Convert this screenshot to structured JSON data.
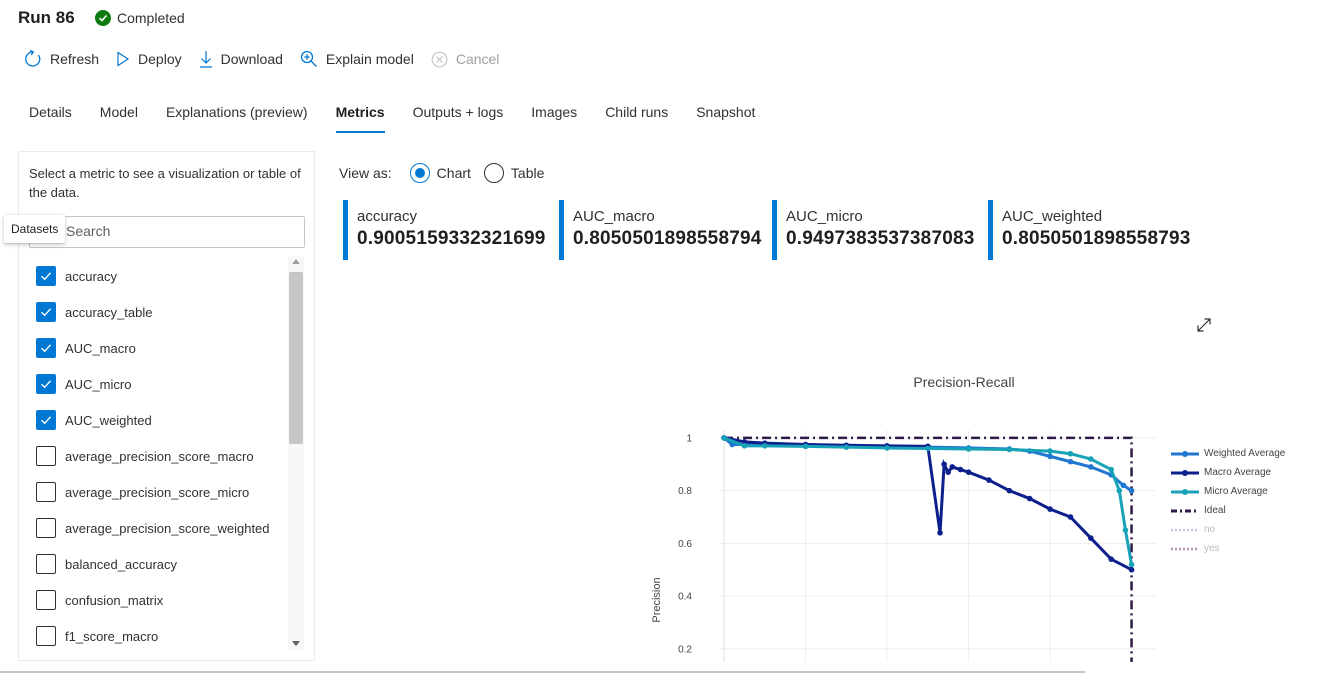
{
  "header": {
    "run_title": "Run 86",
    "status": "Completed",
    "status_color": "#107c10"
  },
  "toolbar": {
    "refresh": "Refresh",
    "deploy": "Deploy",
    "download": "Download",
    "explain_model": "Explain model",
    "cancel": "Cancel"
  },
  "tabs": [
    {
      "label": "Details",
      "active": false
    },
    {
      "label": "Model",
      "active": false
    },
    {
      "label": "Explanations (preview)",
      "active": false
    },
    {
      "label": "Metrics",
      "active": true
    },
    {
      "label": "Outputs + logs",
      "active": false
    },
    {
      "label": "Images",
      "active": false
    },
    {
      "label": "Child runs",
      "active": false
    },
    {
      "label": "Snapshot",
      "active": false
    }
  ],
  "left_panel": {
    "hint": "Select a metric to see a visualization or table of the data.",
    "search_placeholder": "Search",
    "tooltip": "Datasets",
    "metrics": [
      {
        "label": "accuracy",
        "checked": true
      },
      {
        "label": "accuracy_table",
        "checked": true
      },
      {
        "label": "AUC_macro",
        "checked": true
      },
      {
        "label": "AUC_micro",
        "checked": true
      },
      {
        "label": "AUC_weighted",
        "checked": true
      },
      {
        "label": "average_precision_score_macro",
        "checked": false
      },
      {
        "label": "average_precision_score_micro",
        "checked": false
      },
      {
        "label": "average_precision_score_weighted",
        "checked": false
      },
      {
        "label": "balanced_accuracy",
        "checked": false
      },
      {
        "label": "confusion_matrix",
        "checked": false
      },
      {
        "label": "f1_score_macro",
        "checked": false
      }
    ]
  },
  "view_as": {
    "label": "View as:",
    "options": [
      {
        "label": "Chart",
        "selected": true
      },
      {
        "label": "Table",
        "selected": false
      }
    ]
  },
  "cards": [
    {
      "name": "accuracy",
      "value": "0.9005159332321699"
    },
    {
      "name": "AUC_macro",
      "value": "0.8050501898558794"
    },
    {
      "name": "AUC_micro",
      "value": "0.9497383537387083"
    },
    {
      "name": "AUC_weighted",
      "value": "0.8050501898558793"
    }
  ],
  "accent_color": "#0078d4",
  "chart_data": {
    "type": "line",
    "title": "Precision-Recall",
    "ylabel": "Precision",
    "xlabel": "",
    "ylim": [
      0.15,
      1.03
    ],
    "xlim": [
      -0.01,
      1.06
    ],
    "y_ticks": [
      "1",
      "0.8",
      "0.6",
      "0.4",
      "0.2"
    ],
    "y_tick_values": [
      1,
      0.8,
      0.6,
      0.4,
      0.2
    ],
    "legend_position": "right",
    "series": [
      {
        "name": "Weighted Average",
        "color": "#1f77d0",
        "dash": "solid",
        "markers": true,
        "dimmed": false,
        "x": [
          0,
          0.02,
          0.1,
          0.2,
          0.3,
          0.4,
          0.5,
          0.6,
          0.7,
          0.75,
          0.8,
          0.85,
          0.9,
          0.95,
          0.98,
          1.0
        ],
        "y": [
          1.0,
          0.975,
          0.975,
          0.972,
          0.97,
          0.968,
          0.965,
          0.962,
          0.958,
          0.95,
          0.93,
          0.91,
          0.89,
          0.86,
          0.82,
          0.8
        ]
      },
      {
        "name": "Macro Average",
        "color": "#0d1f8c",
        "dash": "solid",
        "markers": true,
        "dimmed": false,
        "x": [
          0,
          0.05,
          0.1,
          0.2,
          0.3,
          0.4,
          0.5,
          0.53,
          0.54,
          0.55,
          0.56,
          0.58,
          0.6,
          0.65,
          0.7,
          0.75,
          0.8,
          0.85,
          0.9,
          0.95,
          1.0
        ],
        "y": [
          1.0,
          0.985,
          0.98,
          0.975,
          0.972,
          0.97,
          0.968,
          0.64,
          0.9,
          0.87,
          0.89,
          0.88,
          0.87,
          0.84,
          0.8,
          0.77,
          0.73,
          0.7,
          0.62,
          0.54,
          0.5
        ]
      },
      {
        "name": "Micro Average",
        "color": "#17a2b8",
        "dash": "solid",
        "markers": true,
        "dimmed": false,
        "x": [
          0,
          0.05,
          0.1,
          0.2,
          0.3,
          0.4,
          0.5,
          0.6,
          0.7,
          0.8,
          0.85,
          0.9,
          0.95,
          0.97,
          0.985,
          1.0
        ],
        "y": [
          1.0,
          0.97,
          0.97,
          0.968,
          0.965,
          0.962,
          0.96,
          0.958,
          0.956,
          0.95,
          0.94,
          0.92,
          0.88,
          0.8,
          0.65,
          0.52
        ]
      },
      {
        "name": "Ideal",
        "color": "#2e1a47",
        "dash": "dashdot",
        "markers": false,
        "dimmed": false,
        "x": [
          0,
          1,
          1
        ],
        "y": [
          1,
          1,
          0
        ]
      },
      {
        "name": "no",
        "color": "#c9c2ea",
        "dash": "dot",
        "markers": false,
        "dimmed": true,
        "x": [],
        "y": []
      },
      {
        "name": "yes",
        "color": "#b88fb6",
        "dash": "dot",
        "markers": false,
        "dimmed": true,
        "x": [],
        "y": []
      }
    ]
  }
}
